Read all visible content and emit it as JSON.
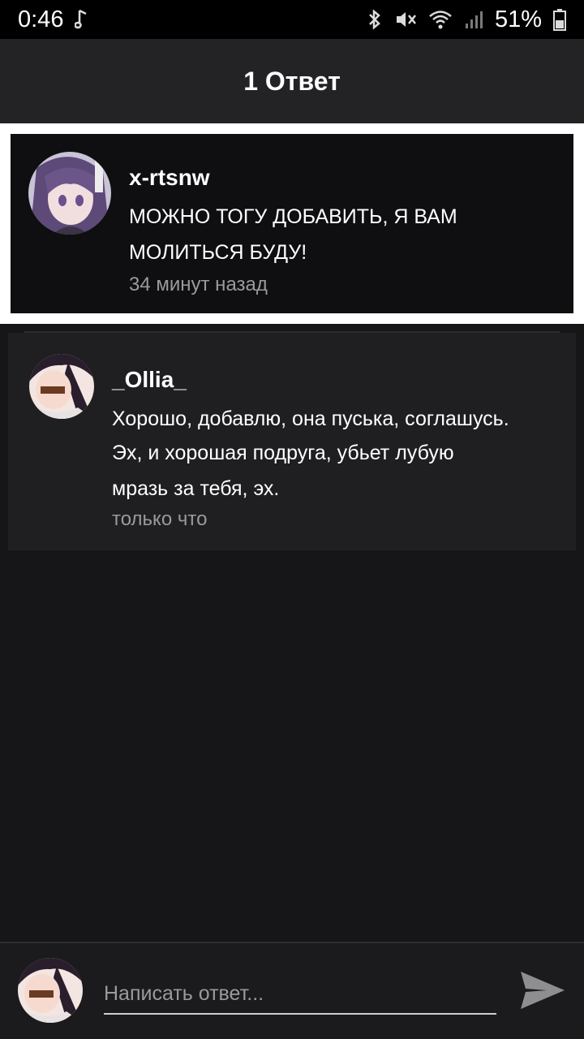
{
  "status_bar": {
    "time": "0:46",
    "battery": "51%",
    "icons": [
      "music-note-icon",
      "bluetooth-icon",
      "mute-icon",
      "wifi-icon",
      "signal-icon",
      "battery-icon"
    ]
  },
  "header": {
    "title": "1 Ответ"
  },
  "root_comment": {
    "username": "x-rtsnw",
    "text_line1": "МОЖНО ТОГУ ДОБАВИТЬ, Я ВАМ",
    "text_line2": "МОЛИТЬСЯ БУДУ!",
    "time": "34 минут назад"
  },
  "reply": {
    "username": "_Ollia_",
    "text_line1": "Хорошо, добавлю, она пуська, соглашусь.",
    "text_line2": "Эх, и хорошая подруга, убьет лубую",
    "text_line3": "мразь за тебя, эх.",
    "time": "только что"
  },
  "composer": {
    "placeholder": "Написать ответ...",
    "send_icon": "send-icon"
  },
  "colors": {
    "background": "#161518",
    "header": "#232224",
    "muted_text": "#9a9a9e"
  }
}
